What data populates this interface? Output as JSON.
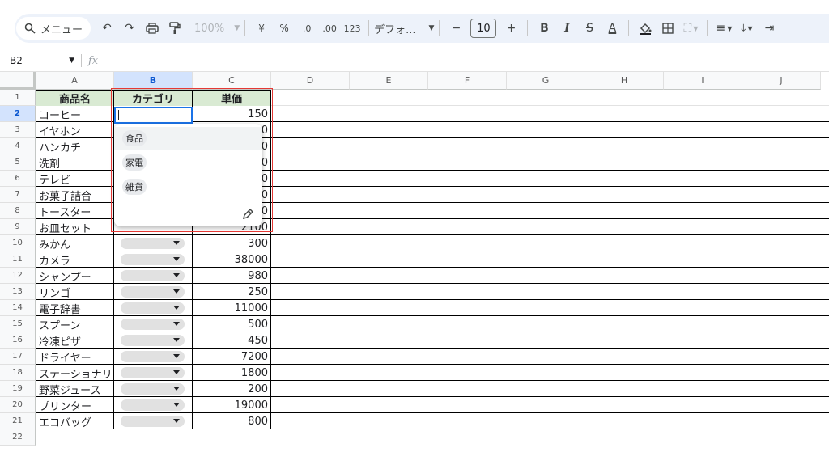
{
  "toolbar": {
    "search_label": "メニュー",
    "zoom": "100%",
    "currency": "¥",
    "percent": "%",
    "dec_decrease": ".0",
    "dec_increase": ".00",
    "number_format": "123",
    "font_name": "デフォ...",
    "font_size": "10",
    "minus": "−",
    "plus": "+",
    "bold": "B",
    "italic": "I",
    "strike": "S",
    "text_color": "A"
  },
  "formula_bar": {
    "name_box": "B2",
    "fx": "fx",
    "value": ""
  },
  "columns": [
    "A",
    "B",
    "C",
    "D",
    "E",
    "F",
    "G",
    "H",
    "I",
    "J"
  ],
  "header_row": {
    "a": "商品名",
    "b": "カテゴリ",
    "c": "単価"
  },
  "rows": [
    {
      "num": "2",
      "a": "コーヒー",
      "c": "150"
    },
    {
      "num": "3",
      "a": "イヤホン",
      "c": "0"
    },
    {
      "num": "4",
      "a": "ハンカチ",
      "c": "0"
    },
    {
      "num": "5",
      "a": "洗剤",
      "c": "0"
    },
    {
      "num": "6",
      "a": "テレビ",
      "c": "0"
    },
    {
      "num": "7",
      "a": "お菓子詰合",
      "c": "0"
    },
    {
      "num": "8",
      "a": "トースター",
      "c": "0"
    },
    {
      "num": "9",
      "a": "お皿セット",
      "c": "2100"
    },
    {
      "num": "10",
      "a": "みかん",
      "c": "300"
    },
    {
      "num": "11",
      "a": "カメラ",
      "c": "38000"
    },
    {
      "num": "12",
      "a": "シャンプー",
      "c": "980"
    },
    {
      "num": "13",
      "a": "リンゴ",
      "c": "250"
    },
    {
      "num": "14",
      "a": "電子辞書",
      "c": "11000"
    },
    {
      "num": "15",
      "a": "スプーン",
      "c": "500"
    },
    {
      "num": "16",
      "a": "冷凍ピザ",
      "c": "450"
    },
    {
      "num": "17",
      "a": "ドライヤー",
      "c": "7200"
    },
    {
      "num": "18",
      "a": "ステーショナリー",
      "c": "1800"
    },
    {
      "num": "19",
      "a": "野菜ジュース",
      "c": "200"
    },
    {
      "num": "20",
      "a": "プリンター",
      "c": "19000"
    },
    {
      "num": "21",
      "a": "エコバッグ",
      "c": "800"
    }
  ],
  "last_row_num": "22",
  "dropdown": {
    "options": [
      "食品",
      "家電",
      "雑貨"
    ]
  },
  "colors": {
    "header_fill": "#d9ead3",
    "accent": "#1a73e8",
    "highlight_box": "#e53935"
  }
}
